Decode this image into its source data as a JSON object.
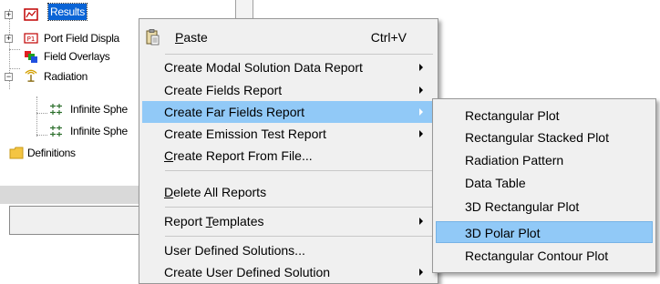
{
  "tree": {
    "items": [
      {
        "label": "Results",
        "icon": "results-icon",
        "selected": true
      },
      {
        "label": "Port Field Displa",
        "icon": "port-field-icon"
      },
      {
        "label": "Field Overlays",
        "icon": "field-overlays-icon"
      },
      {
        "label": "Radiation",
        "icon": "radiation-icon"
      },
      {
        "label": "Infinite Sphe",
        "icon": "infinite-sphere-icon"
      },
      {
        "label": "Infinite Sphe",
        "icon": "infinite-sphere-icon"
      },
      {
        "label": "Definitions",
        "icon": "folder-icon"
      }
    ]
  },
  "context_menu": {
    "items": [
      {
        "label": "Paste",
        "mnemonic": "P",
        "shortcut": "Ctrl+V",
        "icon": "paste-icon"
      },
      {
        "label": "Create Modal Solution Data Report",
        "submenu": true
      },
      {
        "label": "Create Fields Report",
        "submenu": true
      },
      {
        "label": "Create Far Fields Report",
        "submenu": true,
        "highlighted": true
      },
      {
        "label": "Create Emission Test Report",
        "submenu": true
      },
      {
        "label": "Create Report From File...",
        "mnemonic": "C"
      },
      {
        "label": "Delete All Reports",
        "mnemonic": "D"
      },
      {
        "label": "Report Templates",
        "mnemonic": "T",
        "submenu": true
      },
      {
        "label": "User Defined Solutions..."
      },
      {
        "label": "Create User Defined Solution",
        "submenu": true
      }
    ]
  },
  "submenu": {
    "items": [
      {
        "label": "Rectangular Plot"
      },
      {
        "label": "Rectangular Stacked Plot"
      },
      {
        "label": "Radiation Pattern"
      },
      {
        "label": "Data Table"
      },
      {
        "label": "3D Rectangular Plot"
      },
      {
        "label": "3D Polar Plot",
        "highlighted": true
      },
      {
        "label": "Rectangular Contour Plot"
      }
    ]
  },
  "colors": {
    "highlight": "#91c9f7",
    "selection": "#0a64d6",
    "menu_bg": "#f0f0f0"
  }
}
